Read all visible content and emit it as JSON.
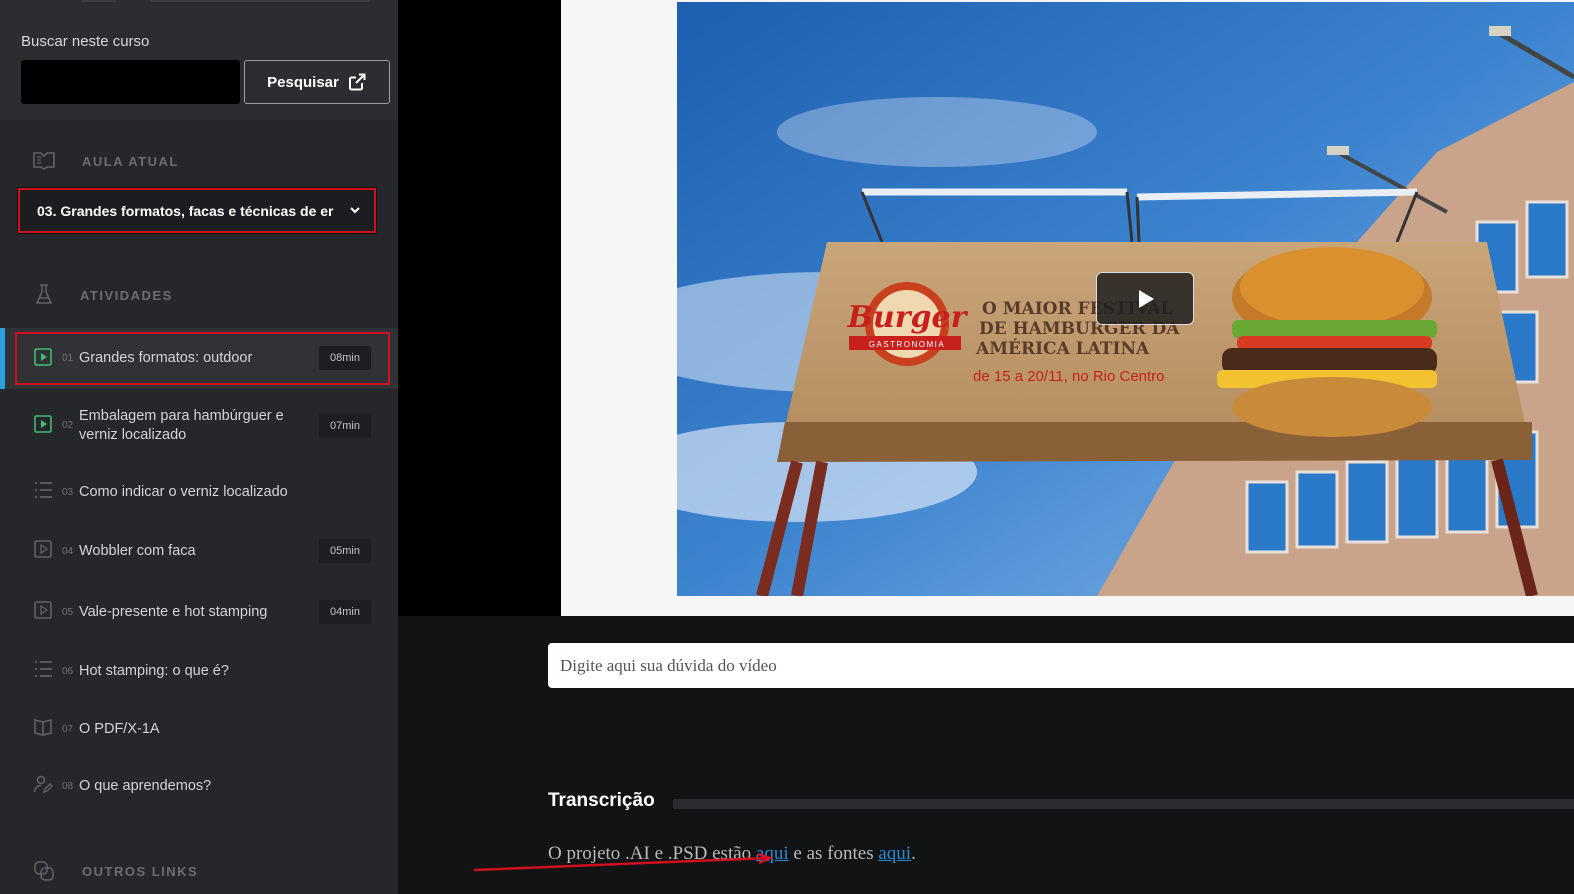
{
  "search": {
    "label": "Buscar neste curso",
    "input_value": "",
    "button_label": "Pesquisar"
  },
  "current_lesson": {
    "heading": "AULA ATUAL",
    "selected": "03. Grandes formatos, facas e técnicas de er"
  },
  "activities": {
    "heading": "ATIVIDADES",
    "items": [
      {
        "num": "01",
        "title": "Grandes formatos: outdoor",
        "duration": "08min",
        "icon": "video-check-icon"
      },
      {
        "num": "02",
        "title": "Embalagem para hambúrguer e verniz localizado",
        "duration": "07min",
        "icon": "video-check-icon"
      },
      {
        "num": "03",
        "title": "Como indicar o verniz localizado",
        "duration": "",
        "icon": "list-icon"
      },
      {
        "num": "04",
        "title": "Wobbler com faca",
        "duration": "05min",
        "icon": "video-icon"
      },
      {
        "num": "05",
        "title": "Vale-presente e hot stamping",
        "duration": "04min",
        "icon": "video-icon"
      },
      {
        "num": "06",
        "title": "Hot stamping: o que é?",
        "duration": "",
        "icon": "list-icon"
      },
      {
        "num": "07",
        "title": "O PDF/X-1A",
        "duration": "",
        "icon": "book-icon"
      },
      {
        "num": "08",
        "title": "O que aprendemos?",
        "duration": "",
        "icon": "user-edit-icon"
      }
    ]
  },
  "other_links": {
    "heading": "OUTROS LINKS"
  },
  "video": {
    "billboard_brand": "Burger",
    "billboard_brand_sub": "GASTRONOMIA",
    "billboard_headline_1": "O MAIOR FESTIVAL",
    "billboard_headline_2": "DE HAMBURGER DA",
    "billboard_headline_3": "AMÉRICA LATINA",
    "billboard_dates": "de 15 a 20/11, no Rio Centro"
  },
  "question": {
    "placeholder": "Digite aqui sua dúvida do vídeo"
  },
  "transcription": {
    "title": "Transcrição",
    "text_before": "O projeto .AI e .PSD estão ",
    "link1": "aqui",
    "text_middle": " e as fontes ",
    "link2": "aqui",
    "text_after": "."
  },
  "colors": {
    "highlight_red": "#d10f1f",
    "current_bar": "#2c9fe0",
    "check_green": "#3fbf6f",
    "link_blue": "#2a8ad8"
  }
}
